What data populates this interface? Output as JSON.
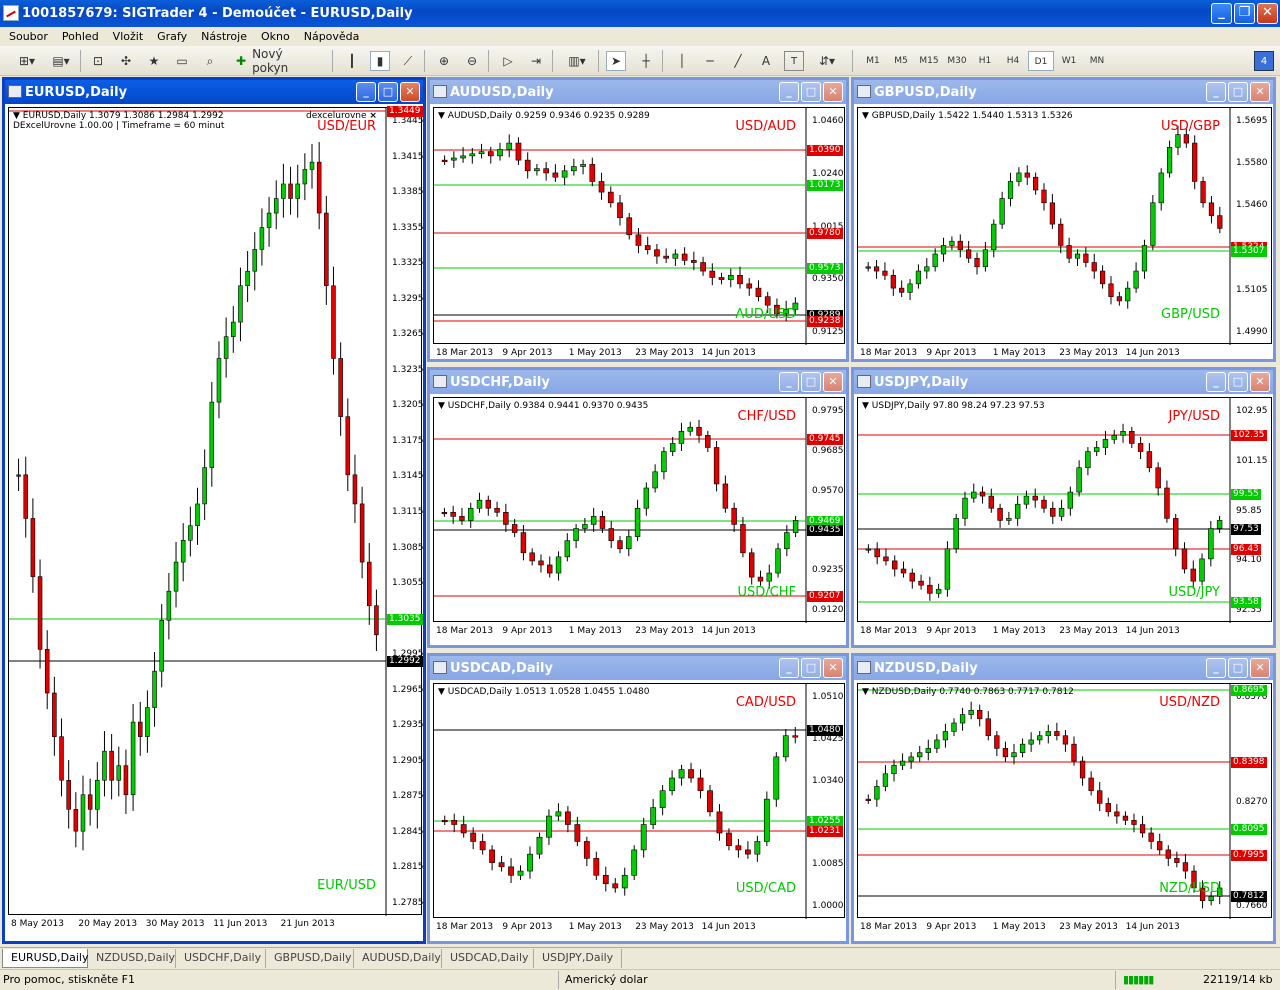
{
  "app": {
    "title": "1001857679: SIGTrader 4 - Demoúčet - EURUSD,Daily"
  },
  "menu": [
    "Soubor",
    "Pohled",
    "Vložit",
    "Grafy",
    "Nástroje",
    "Okno",
    "Nápověda"
  ],
  "toolbar": {
    "new_order_label": "Nový pokyn",
    "timeframes": [
      "M1",
      "M5",
      "M15",
      "M30",
      "H1",
      "H4",
      "D1",
      "W1",
      "MN"
    ],
    "active_timeframe": "D1",
    "badge": "4",
    "line_text_tool": "A",
    "text_label_tool": "T"
  },
  "windows": [
    {
      "id": "eurusd",
      "title": "EURUSD,Daily",
      "info_line1": "EURUSD,Daily  1.3079 1.3086 1.2984 1.2992",
      "info_line2": "DExcelUrovne 1.00.00  |  Timeframe = 60 minut",
      "indicator_label": "dexcelurovne",
      "pair_top": "USD/EUR",
      "pair_bottom": "EUR/USD",
      "y_labels": [
        "1.3445",
        "1.3415",
        "1.3385",
        "1.3355",
        "1.3325",
        "1.3295",
        "1.3265",
        "1.3235",
        "1.3205",
        "1.3175",
        "1.3145",
        "1.3115",
        "1.3085",
        "1.3055",
        "1.3025",
        "1.2995",
        "1.2965",
        "1.2935",
        "1.2905",
        "1.2875",
        "1.2845",
        "1.2815",
        "1.2785"
      ],
      "price_tags": [
        {
          "value": "1.3035",
          "color": "#00cc00"
        },
        {
          "value": "1.2992",
          "color": "#000000"
        },
        {
          "value": "1.3449",
          "color": "#e00000"
        }
      ],
      "x_labels": [
        "8 May 2013",
        "20 May 2013",
        "30 May 2013",
        "11 Jun 2013",
        "21 Jun 2013"
      ]
    },
    {
      "id": "audusd",
      "title": "AUDUSD,Daily",
      "info_line1": "AUDUSD,Daily  0.9259 0.9346 0.9235 0.9289",
      "pair_top": "USD/AUD",
      "pair_bottom": "AUD/USD",
      "y_labels": [
        "1.0460",
        "1.0240",
        "1.0015",
        "0.9350",
        "0.9125"
      ],
      "price_tags": [
        {
          "value": "1.0390",
          "color": "#e00000"
        },
        {
          "value": "1.0173",
          "color": "#00cc00"
        },
        {
          "value": "0.9780",
          "color": "#e00000"
        },
        {
          "value": "0.9573",
          "color": "#00cc00"
        },
        {
          "value": "0.9289",
          "color": "#000000"
        },
        {
          "value": "0.9238",
          "color": "#e00000"
        }
      ],
      "x_labels": [
        "18 Mar 2013",
        "9 Apr 2013",
        "1 May 2013",
        "23 May 2013",
        "14 Jun 2013"
      ]
    },
    {
      "id": "gbpusd",
      "title": "GBPUSD,Daily",
      "info_line1": "GBPUSD,Daily  1.5422 1.5440 1.5313 1.5326",
      "pair_top": "USD/GBP",
      "pair_bottom": "GBP/USD",
      "y_labels": [
        "1.5695",
        "1.5580",
        "1.5460",
        "1.5220",
        "1.5105",
        "1.4990"
      ],
      "price_tags": [
        {
          "value": "1.5324",
          "color": "#e00000"
        },
        {
          "value": "1.5307",
          "color": "#00cc00"
        }
      ],
      "x_labels": [
        "18 Mar 2013",
        "9 Apr 2013",
        "1 May 2013",
        "23 May 2013",
        "14 Jun 2013"
      ]
    },
    {
      "id": "usdchf",
      "title": "USDCHF,Daily",
      "info_line1": "USDCHF,Daily  0.9384 0.9441 0.9370 0.9435",
      "pair_top": "CHF/USD",
      "pair_bottom": "USD/CHF",
      "y_labels": [
        "0.9795",
        "0.9685",
        "0.9570",
        "0.9345",
        "0.9235",
        "0.9120"
      ],
      "price_tags": [
        {
          "value": "0.9745",
          "color": "#e00000"
        },
        {
          "value": "0.9469",
          "color": "#00cc00"
        },
        {
          "value": "0.9435",
          "color": "#000000"
        },
        {
          "value": "0.9207",
          "color": "#e00000"
        }
      ],
      "x_labels": [
        "18 Mar 2013",
        "9 Apr 2013",
        "1 May 2013",
        "23 May 2013",
        "14 Jun 2013"
      ]
    },
    {
      "id": "usdjpy",
      "title": "USDJPY,Daily",
      "info_line1": "USDJPY,Daily  97.80 98.24 97.23 97.53",
      "pair_top": "JPY/USD",
      "pair_bottom": "USD/JPY",
      "y_labels": [
        "102.95",
        "101.15",
        "95.85",
        "94.10",
        "92.35"
      ],
      "price_tags": [
        {
          "value": "102.35",
          "color": "#e00000"
        },
        {
          "value": "99.55",
          "color": "#00cc00"
        },
        {
          "value": "97.53",
          "color": "#000000"
        },
        {
          "value": "96.43",
          "color": "#e00000"
        },
        {
          "value": "93.58",
          "color": "#00cc00"
        }
      ],
      "x_labels": [
        "18 Mar 2013",
        "9 Apr 2013",
        "1 May 2013",
        "23 May 2013",
        "14 Jun 2013"
      ]
    },
    {
      "id": "usdcad",
      "title": "USDCAD,Daily",
      "info_line1": "USDCAD,Daily  1.0513 1.0528 1.0455 1.0480",
      "pair_top": "CAD/USD",
      "pair_bottom": "USD/CAD",
      "y_labels": [
        "1.0510",
        "1.0425",
        "1.0340",
        "1.0170",
        "1.0085",
        "1.0000"
      ],
      "price_tags": [
        {
          "value": "1.0480",
          "color": "#000000"
        },
        {
          "value": "1.0255",
          "color": "#00cc00"
        },
        {
          "value": "1.0231",
          "color": "#e00000"
        }
      ],
      "x_labels": [
        "18 Mar 2013",
        "9 Apr 2013",
        "1 May 2013",
        "23 May 2013",
        "14 Jun 2013"
      ]
    },
    {
      "id": "nzdusd",
      "title": "NZDUSD,Daily",
      "info_line1": "NZDUSD,Daily  0.7740 0.7863 0.7717 0.7812",
      "pair_top": "USD/NZD",
      "pair_bottom": "NZD/USD",
      "y_labels": [
        "0.8570",
        "0.8270",
        "0.7660"
      ],
      "price_tags": [
        {
          "value": "0.8695",
          "color": "#00cc00"
        },
        {
          "value": "0.8398",
          "color": "#e00000"
        },
        {
          "value": "0.8095",
          "color": "#00cc00"
        },
        {
          "value": "0.7995",
          "color": "#e00000"
        },
        {
          "value": "0.7812",
          "color": "#000000"
        }
      ],
      "x_labels": [
        "18 Mar 2013",
        "9 Apr 2013",
        "1 May 2013",
        "23 May 2013",
        "14 Jun 2013"
      ]
    }
  ],
  "tabs": [
    "EURUSD,Daily",
    "NZDUSD,Daily",
    "USDCHF,Daily",
    "GBPUSD,Daily",
    "AUDUSD,Daily",
    "USDCAD,Daily",
    "USDJPY,Daily"
  ],
  "status": {
    "help": "Pro pomoc, stiskněte F1",
    "profile": "Americký dolar",
    "traffic": "22119/14 kb"
  },
  "colors": {
    "bull": "#00cc00",
    "bear": "#e00000",
    "active_title": "#0a3fc4",
    "inactive_title": "#7a96df"
  }
}
